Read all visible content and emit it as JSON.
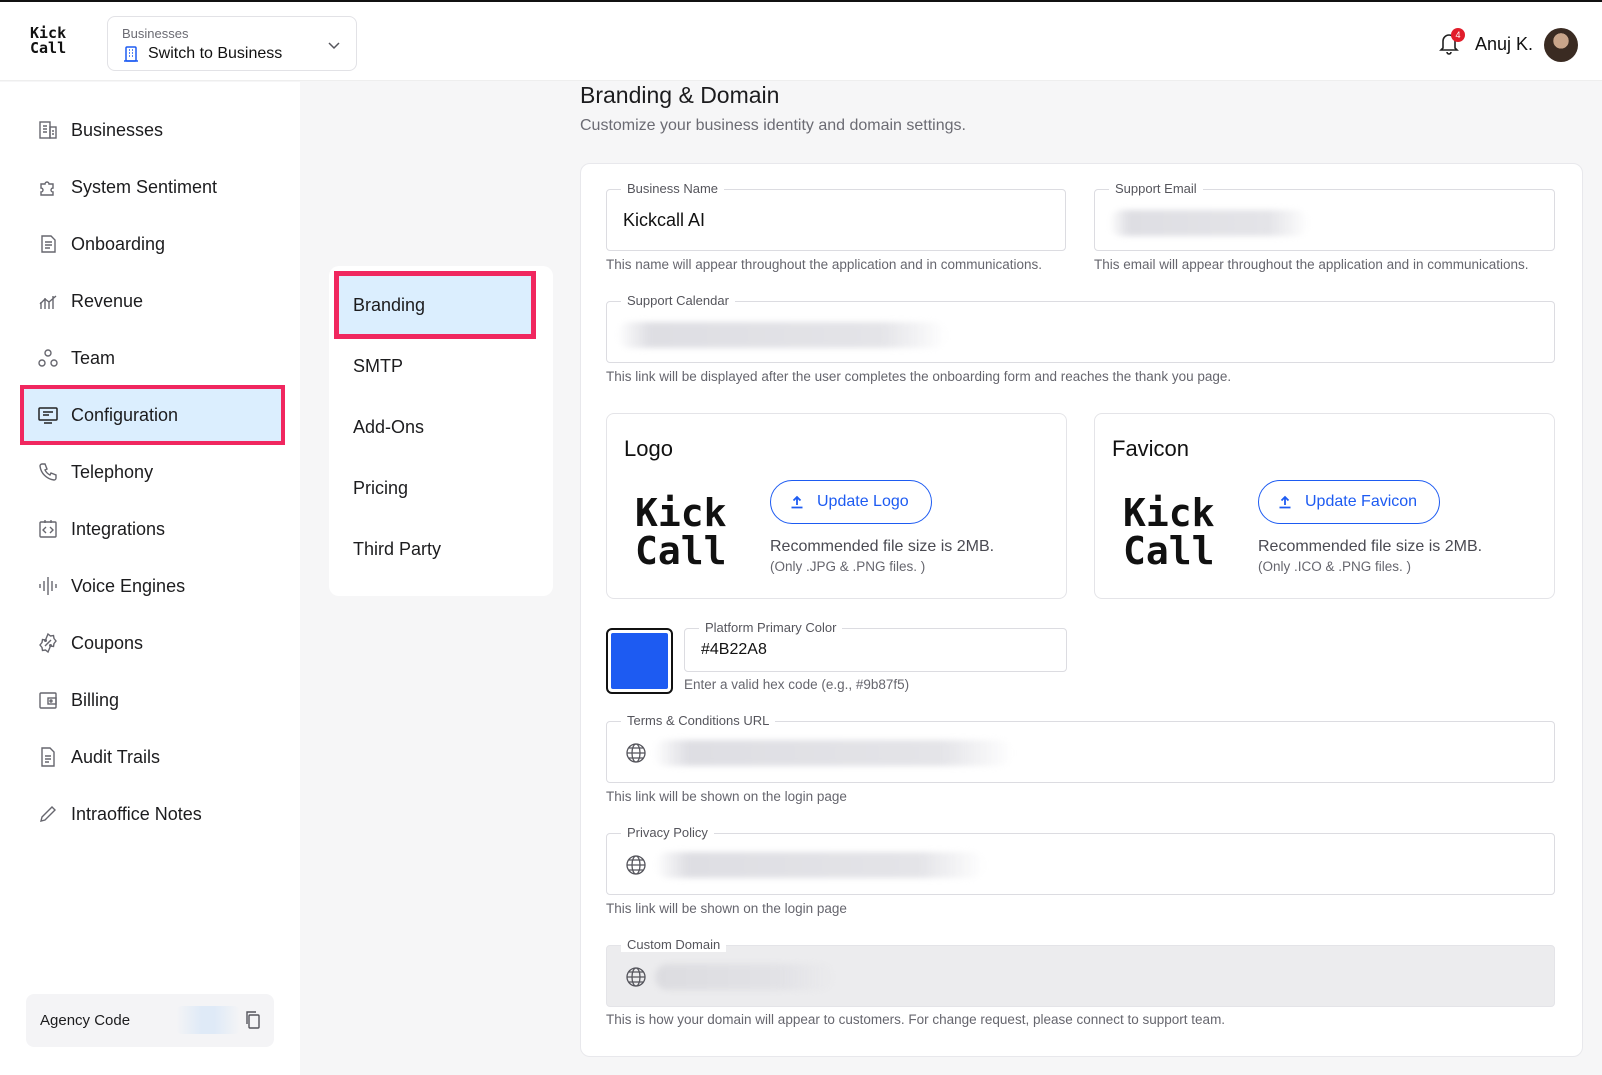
{
  "header": {
    "logo": [
      "Kick",
      "Call"
    ],
    "business_switch": {
      "caption": "Businesses",
      "value": "Switch to Business"
    },
    "notifications_count": "4",
    "user_name": "Anuj K."
  },
  "sidebar": {
    "items": [
      {
        "label": "Businesses",
        "icon": "building-icon"
      },
      {
        "label": "System Sentiment",
        "icon": "puzzle-icon"
      },
      {
        "label": "Onboarding",
        "icon": "document-icon"
      },
      {
        "label": "Revenue",
        "icon": "chart-icon"
      },
      {
        "label": "Team",
        "icon": "team-icon"
      },
      {
        "label": "Configuration",
        "icon": "monitor-icon",
        "active": true
      },
      {
        "label": "Telephony",
        "icon": "phone-icon"
      },
      {
        "label": "Integrations",
        "icon": "code-icon"
      },
      {
        "label": "Voice Engines",
        "icon": "waveform-icon"
      },
      {
        "label": "Coupons",
        "icon": "coupon-icon"
      },
      {
        "label": "Billing",
        "icon": "wallet-icon"
      },
      {
        "label": "Audit Trails",
        "icon": "file-icon"
      },
      {
        "label": "Intraoffice Notes",
        "icon": "pencil-icon"
      }
    ],
    "agency_code_label": "Agency Code"
  },
  "submenu": {
    "items": [
      {
        "label": "Branding",
        "active": true
      },
      {
        "label": "SMTP"
      },
      {
        "label": "Add-Ons"
      },
      {
        "label": "Pricing"
      },
      {
        "label": "Third Party"
      }
    ]
  },
  "main": {
    "title": "Branding & Domain",
    "subtitle": "Customize your business identity and domain settings.",
    "business_name": {
      "label": "Business Name",
      "value": "Kickcall AI",
      "hint": "This name will appear throughout the application and in communications."
    },
    "support_email": {
      "label": "Support Email",
      "hint": "This email will appear throughout the application and in communications."
    },
    "support_calendar": {
      "label": "Support Calendar",
      "hint": "This link will be displayed after the user completes the onboarding form and reaches the thank you page."
    },
    "logo": {
      "title": "Logo",
      "mark": [
        "Kick",
        "Call"
      ],
      "button": "Update Logo",
      "recommend": "Recommended file size is 2MB.",
      "types": "(Only .JPG & .PNG files. )"
    },
    "favicon": {
      "title": "Favicon",
      "mark": [
        "Kick",
        "Call"
      ],
      "button": "Update Favicon",
      "recommend": "Recommended file size is 2MB.",
      "types": "(Only .ICO & .PNG files. )"
    },
    "primary_color": {
      "label": "Platform Primary Color",
      "value": "#4B22A8",
      "hint": "Enter a valid hex code (e.g., #9b87f5)",
      "swatch": "#1d5bf2"
    },
    "terms_url": {
      "label": "Terms & Conditions URL",
      "hint": "This link will be shown on the login page"
    },
    "privacy_policy": {
      "label": "Privacy Policy",
      "hint": "This link will be shown on the login page"
    },
    "custom_domain": {
      "label": "Custom Domain",
      "hint": "This is how your domain will appear to customers. For change request, please connect to support team."
    }
  },
  "colors": {
    "accent": "#1d5bf2",
    "highlight": "#f0275f",
    "active_bg": "#dbeefe"
  }
}
